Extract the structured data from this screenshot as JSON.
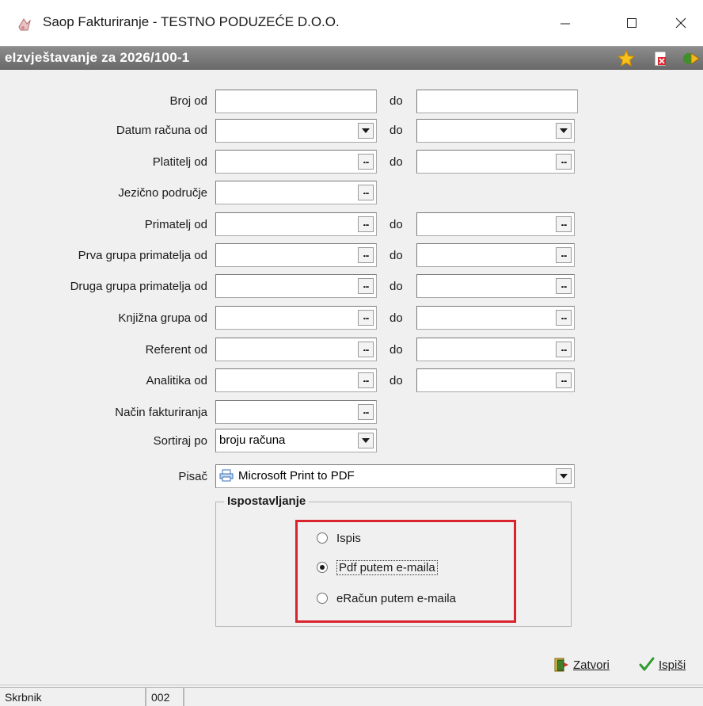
{
  "window": {
    "title": "Saop Fakturiranje - TESTNO PODUZEĆE D.O.O."
  },
  "header": {
    "title": "eIzvještavanje za 2026/100-1",
    "icons": [
      "star-icon",
      "delete-report-icon",
      "run-icon"
    ]
  },
  "form": {
    "rows": [
      {
        "label": "Broj od",
        "from": "",
        "to_label": "do",
        "to": ""
      },
      {
        "label": "Datum računa od",
        "from": "",
        "to_label": "do",
        "to": ""
      },
      {
        "label": "Platitelj od",
        "from": "",
        "to_label": "do",
        "to": ""
      },
      {
        "label": "Jezično područje",
        "from": ""
      },
      {
        "label": "Primatelj od",
        "from": "",
        "to_label": "do",
        "to": ""
      },
      {
        "label": "Prva grupa primatelja od",
        "from": "",
        "to_label": "do",
        "to": ""
      },
      {
        "label": "Druga grupa primatelja od",
        "from": "",
        "to_label": "do",
        "to": ""
      },
      {
        "label": "Knjižna grupa od",
        "from": "",
        "to_label": "do",
        "to": ""
      },
      {
        "label": "Referent od",
        "from": "",
        "to_label": "do",
        "to": ""
      },
      {
        "label": "Analitika od",
        "from": "",
        "to_label": "do",
        "to": ""
      },
      {
        "label": "Način fakturiranja",
        "from": ""
      }
    ],
    "sort": {
      "label": "Sortiraj po",
      "value": "broju računa"
    },
    "printer": {
      "label": "Pisač",
      "value": "Microsoft Print to PDF"
    }
  },
  "delivery": {
    "group_title": "Ispostavljanje",
    "options": [
      {
        "label": "Ispis",
        "selected": false
      },
      {
        "label": "Pdf putem e-maila",
        "selected": true
      },
      {
        "label": "eRačun putem e-maila",
        "selected": false
      }
    ],
    "highlight_color": "#d9232d"
  },
  "buttons": {
    "close_label": "Zatvori",
    "print_label": "Ispiši"
  },
  "status": {
    "user": "Skrbnik",
    "code": "002"
  }
}
